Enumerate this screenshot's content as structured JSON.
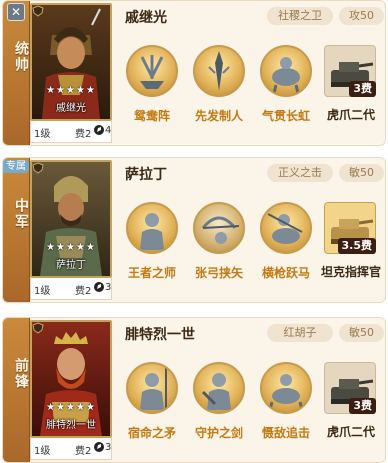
{
  "cards": [
    {
      "role": "统帅",
      "name": "戚继光",
      "portrait_name": "戚继光",
      "stars": "★★★★★",
      "level": "1级",
      "cost": "费2",
      "horse_count": "4",
      "tags": [
        "社稷之卫",
        "攻50"
      ],
      "skills": [
        "鸳鸯阵",
        "先发制人",
        "气贯长虹"
      ],
      "tank": {
        "cost": "3费",
        "label": "虎爪二代"
      }
    },
    {
      "role": "中军",
      "special": "专属",
      "name": "萨拉丁",
      "portrait_name": "萨拉丁",
      "stars": "★★★★★",
      "level": "1级",
      "cost": "费2",
      "horse_count": "3",
      "tags": [
        "正义之击",
        "敏50"
      ],
      "skills": [
        "王者之师",
        "张弓挟矢",
        "横枪跃马"
      ],
      "tank": {
        "cost": "3.5费",
        "label": "坦克指挥官"
      }
    },
    {
      "role": "前锋",
      "name": "腓特烈一世",
      "portrait_name": "腓特烈一世",
      "stars": "★★★★★",
      "level": "1级",
      "cost": "费2",
      "horse_count": "3",
      "tags": [
        "红胡子",
        "敏50"
      ],
      "skills": [
        "宿命之矛",
        "守护之剑",
        "慑敌追击"
      ],
      "tank": {
        "cost": "3费",
        "label": "虎爪二代"
      }
    }
  ]
}
